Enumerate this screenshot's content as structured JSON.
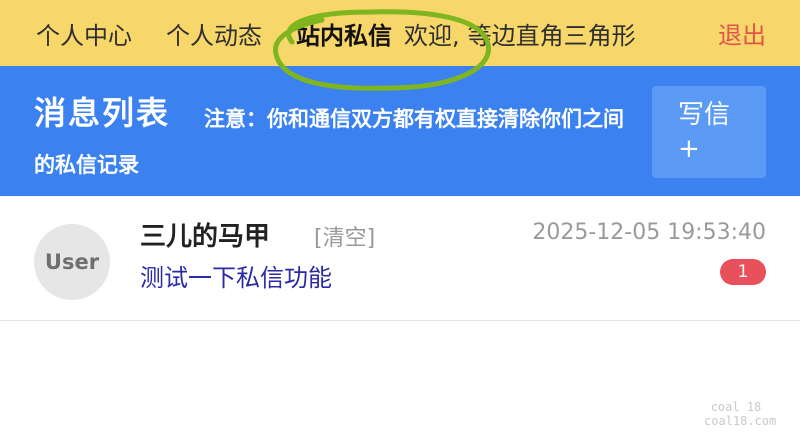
{
  "nav": {
    "personal_center": "个人中心",
    "personal_activity": "个人动态",
    "site_messages": "站内私信",
    "welcome_prefix": "欢迎,",
    "username": "等边直角三角形",
    "logout": "退出"
  },
  "header": {
    "title": "消息列表",
    "notice": "注意：你和通信双方都有权直接清除你们之间的私信记录",
    "write_label": "写信",
    "write_plus": "+"
  },
  "messages": [
    {
      "avatar_text": "User",
      "sender": "三儿的马甲",
      "clear_label": "[清空]",
      "timestamp": "2025-12-05 19:53:40",
      "preview": "测试一下私信功能",
      "unread_count": "1"
    }
  ],
  "watermark": {
    "line1": "coal 18",
    "line2": "coal18.com"
  },
  "colors": {
    "nav_bg": "#f7d76a",
    "header_bg": "#3b82f0",
    "logout": "#e2534a",
    "preview_text": "#2a2aa6",
    "badge_bg": "#e8505b",
    "scribble": "#7fb51f"
  }
}
